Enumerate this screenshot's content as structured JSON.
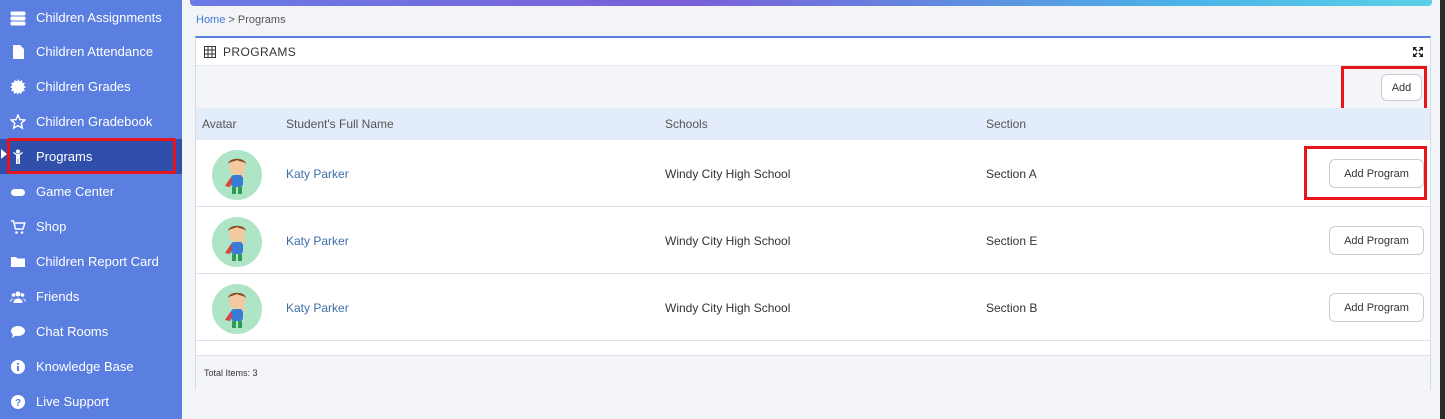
{
  "sidebar": {
    "items": [
      {
        "label": "Children Assignments",
        "icon": "list-icon"
      },
      {
        "label": "Children Attendance",
        "icon": "file-icon"
      },
      {
        "label": "Children Grades",
        "icon": "badge-icon"
      },
      {
        "label": "Children Gradebook",
        "icon": "star-icon"
      },
      {
        "label": "Programs",
        "icon": "child-icon",
        "active": true
      },
      {
        "label": "Game Center",
        "icon": "gamepad-icon"
      },
      {
        "label": "Shop",
        "icon": "cart-icon"
      },
      {
        "label": "Children Report Card",
        "icon": "folder-icon"
      },
      {
        "label": "Friends",
        "icon": "users-icon"
      },
      {
        "label": "Chat Rooms",
        "icon": "chat-icon"
      },
      {
        "label": "Knowledge Base",
        "icon": "info-icon"
      },
      {
        "label": "Live Support",
        "icon": "question-icon"
      }
    ]
  },
  "breadcrumb": {
    "home": "Home",
    "separator": " > ",
    "current": "Programs"
  },
  "panel": {
    "title": "PROGRAMS",
    "add_label": "Add",
    "columns": [
      "Avatar",
      "Student's Full Name",
      "Schools",
      "Section"
    ],
    "rows": [
      {
        "name": "Katy Parker",
        "school": "Windy City High School",
        "section": "Section A",
        "action": "Add Program"
      },
      {
        "name": "Katy Parker",
        "school": "Windy City High School",
        "section": "Section E",
        "action": "Add Program"
      },
      {
        "name": "Katy Parker",
        "school": "Windy City High School",
        "section": "Section B",
        "action": "Add Program"
      }
    ],
    "footer": "Total Items: 3"
  },
  "colors": {
    "sidebar": "#5b7fe0",
    "active": "#2f4fab",
    "highlight": "#e8141c",
    "link": "#3d6ea8"
  }
}
